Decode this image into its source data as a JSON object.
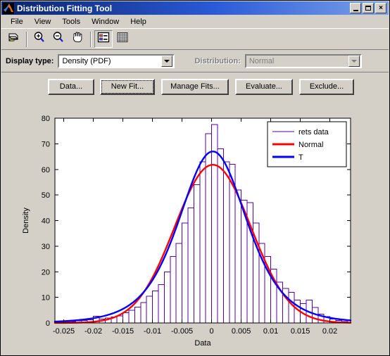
{
  "window": {
    "title": "Distribution Fitting Tool",
    "icon": "matlab-logo-icon",
    "minimize_label": "",
    "maximize_label": "",
    "close_label": "×"
  },
  "menubar": {
    "items": [
      {
        "label": "File"
      },
      {
        "label": "View"
      },
      {
        "label": "Tools"
      },
      {
        "label": "Window"
      },
      {
        "label": "Help"
      }
    ]
  },
  "toolbar": {
    "buttons": [
      {
        "name": "print-icon",
        "tooltip": "Print"
      },
      {
        "name": "zoom-in-icon",
        "tooltip": "Zoom In"
      },
      {
        "name": "zoom-out-icon",
        "tooltip": "Zoom Out"
      },
      {
        "name": "pan-hand-icon",
        "tooltip": "Pan"
      },
      {
        "name": "legend-icon",
        "tooltip": "Legend"
      },
      {
        "name": "grid-icon",
        "tooltip": "Grid"
      }
    ]
  },
  "display_bar": {
    "display_type_label": "Display type:",
    "display_type_value": "Density (PDF)",
    "distribution_label": "Distribution:",
    "distribution_value": "Normal",
    "distribution_disabled": true
  },
  "action_buttons": [
    {
      "label": "Data...",
      "name": "data-button",
      "focused": false
    },
    {
      "label": "New Fit...",
      "name": "new-fit-button",
      "focused": true
    },
    {
      "label": "Manage Fits...",
      "name": "manage-fits-button",
      "focused": false
    },
    {
      "label": "Evaluate...",
      "name": "evaluate-button",
      "focused": false
    },
    {
      "label": "Exclude...",
      "name": "exclude-button",
      "focused": false
    }
  ],
  "chart_data": {
    "type": "bar",
    "title": "",
    "xlabel": "Data",
    "ylabel": "Density",
    "xlim": [
      -0.0265,
      0.0235
    ],
    "ylim": [
      0,
      80
    ],
    "xticks": [
      -0.025,
      -0.02,
      -0.015,
      -0.01,
      -0.005,
      0,
      0.005,
      0.01,
      0.015,
      0.02
    ],
    "xticklabels": [
      "-0.025",
      "-0.02",
      "-0.015",
      "-0.01",
      "-0.005",
      "0",
      "0.005",
      "0.01",
      "0.015",
      "0.02"
    ],
    "yticks": [
      0,
      10,
      20,
      30,
      40,
      50,
      60,
      70,
      80
    ],
    "yticklabels": [
      "0",
      "10",
      "20",
      "30",
      "40",
      "50",
      "60",
      "70",
      "80"
    ],
    "grid": false,
    "legend_position": "top-right",
    "colors": {
      "histogram": "#5500aa",
      "normal": "#ff0000",
      "t": "#0000ff",
      "axes_background": "#ffffff",
      "panel_background": "#d4d0c8"
    },
    "series": [
      {
        "name": "rets data",
        "type": "histogram",
        "color": "#5500aa",
        "bin_width": 0.001,
        "bin_centers": [
          -0.0255,
          -0.0245,
          -0.0235,
          -0.0225,
          -0.0215,
          -0.0205,
          -0.0195,
          -0.0185,
          -0.0175,
          -0.0165,
          -0.0155,
          -0.0145,
          -0.0135,
          -0.0125,
          -0.0115,
          -0.0105,
          -0.0095,
          -0.0085,
          -0.0075,
          -0.0065,
          -0.0055,
          -0.0045,
          -0.0035,
          -0.0025,
          -0.0015,
          -0.0005,
          0.0005,
          0.0015,
          0.0025,
          0.0035,
          0.0045,
          0.0055,
          0.0065,
          0.0075,
          0.0085,
          0.0095,
          0.0105,
          0.0115,
          0.0125,
          0.0135,
          0.0145,
          0.0155,
          0.0165,
          0.0175,
          0.0185,
          0.0195,
          0.0205,
          0.0215,
          0.0225
        ],
        "values": [
          0.4,
          0.4,
          0.5,
          0.8,
          1.0,
          1.3,
          2.6,
          1.5,
          1.9,
          2.4,
          2.8,
          4.0,
          5.0,
          6.2,
          8.0,
          10.5,
          12.5,
          15.0,
          20.0,
          26.0,
          31.0,
          39.0,
          45.0,
          54.0,
          63.0,
          74.0,
          77.5,
          68.0,
          63.0,
          62.0,
          52.0,
          48.0,
          47.0,
          39.0,
          31.0,
          26.0,
          21.0,
          16.0,
          13.5,
          12.0,
          9.0,
          7.5,
          9.0,
          6.0,
          3.5,
          2.5,
          1.5,
          1.0,
          0.6
        ]
      },
      {
        "name": "Normal",
        "type": "line",
        "color": "#ff0000",
        "mu": 0.0002,
        "sigma": 0.00645,
        "peak": 61.8
      },
      {
        "name": "T",
        "type": "line",
        "color": "#0000ff",
        "mu": 0.0002,
        "sigma": 0.00595,
        "nu": 5,
        "peak": 67.0
      }
    ],
    "legend": [
      {
        "label": "rets data",
        "color": "#5500aa",
        "width": 1
      },
      {
        "label": "Normal",
        "color": "#ff0000",
        "width": 3
      },
      {
        "label": "T",
        "color": "#0000ff",
        "width": 3
      }
    ]
  }
}
